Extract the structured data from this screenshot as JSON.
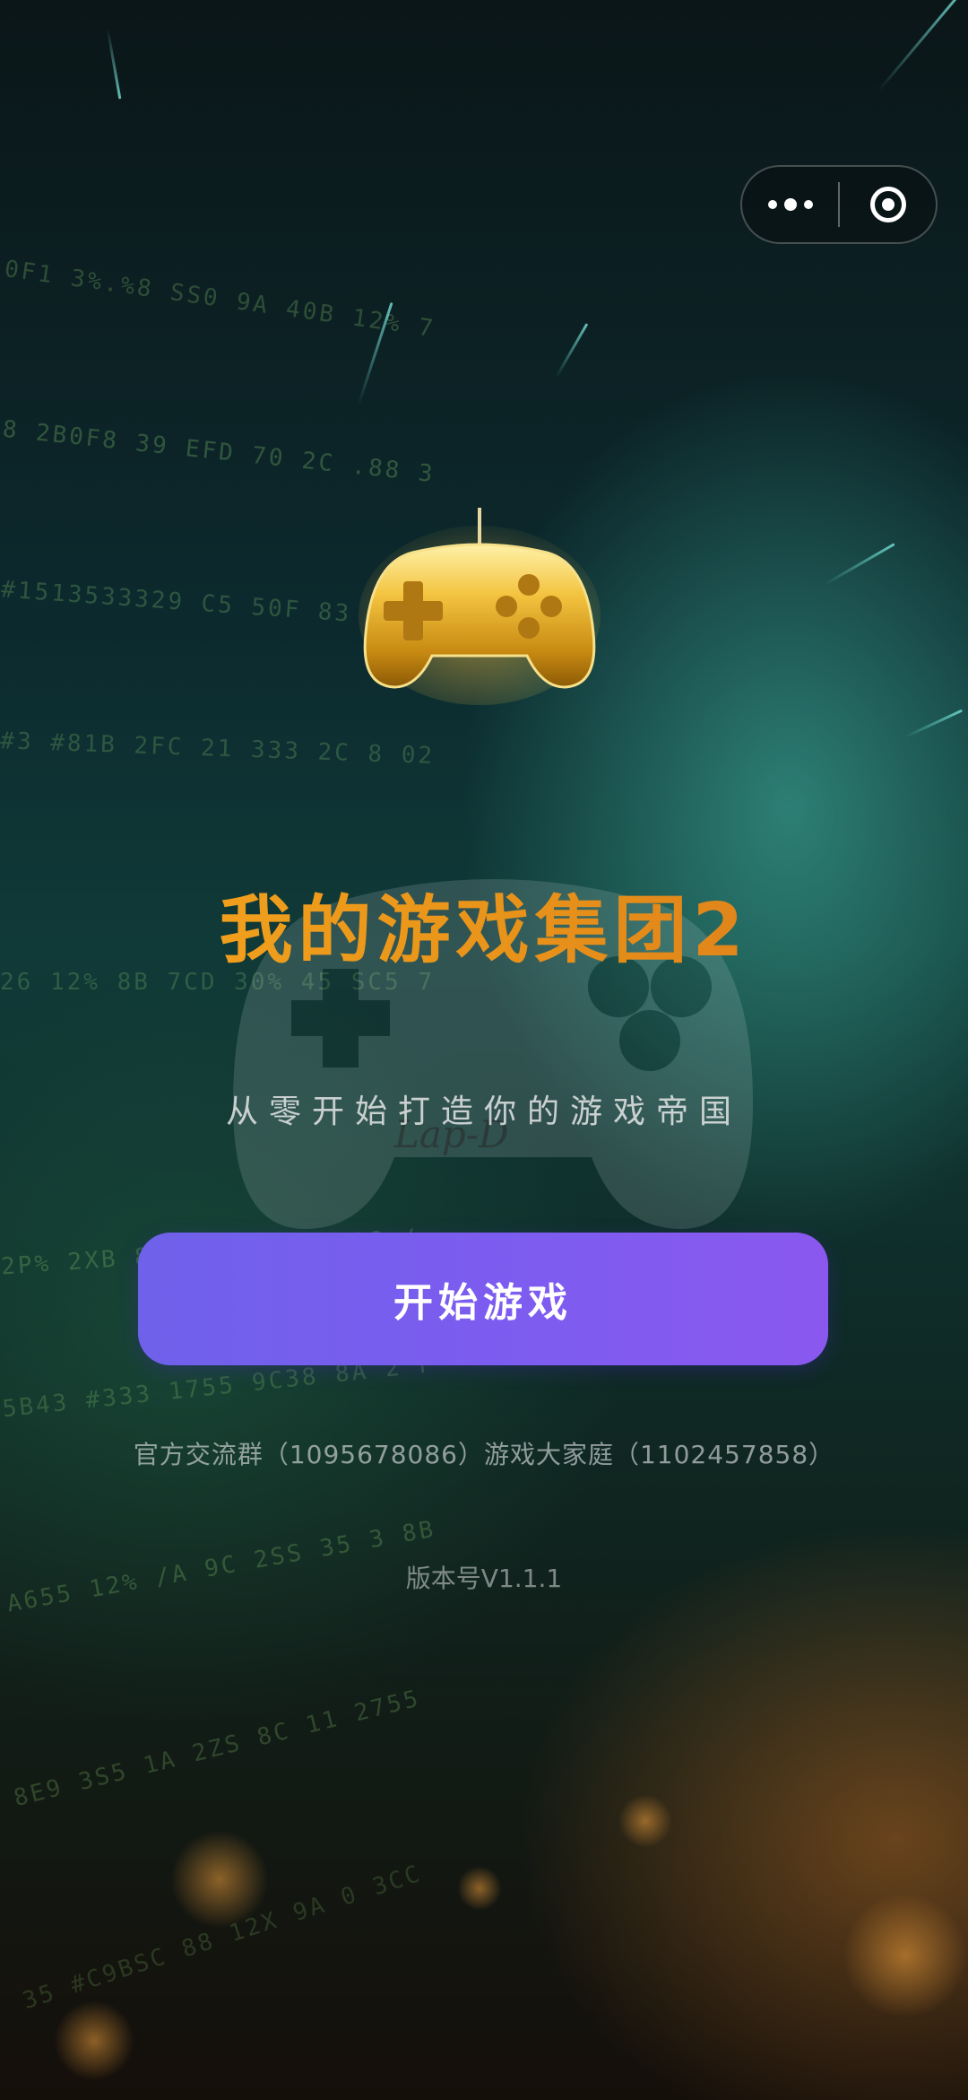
{
  "game": {
    "title": "我的游戏集团2",
    "subtitle": "从零开始打造你的游戏帝国",
    "start_label": "开始游戏",
    "groups_text": "官方交流群（1095678086）游戏大家庭（1102457858）",
    "version_text": "版本号V1.1.1",
    "watermark_text": "Lap-D"
  },
  "decor": {
    "stream_lines": [
      "0F1 3%.%8 SS0 9A 40B 12% 7",
      "8 2B0F8 39 EFD 70 2C .88 3",
      "#1513533329 C5 50F 83 58 8",
      "#3 #81B 2FC 21 333 2C 8 02",
      "26 12% 8B 7CD 30% 45 SC5 7",
      "2P% 2XB 83 #C9BSC 38 2C /",
      "5B43 #333 1755 9C38 8A 2 F",
      "A655 12% /A 9C 2SS 35 3 8B",
      "8E9 3S5 1A 2ZS 8C 11 2755",
      "35 #C9BSC 88 12X 9A 0 3CC"
    ]
  },
  "colors": {
    "accent_button": "#7b5df0",
    "title_gold": "#f0a020"
  }
}
